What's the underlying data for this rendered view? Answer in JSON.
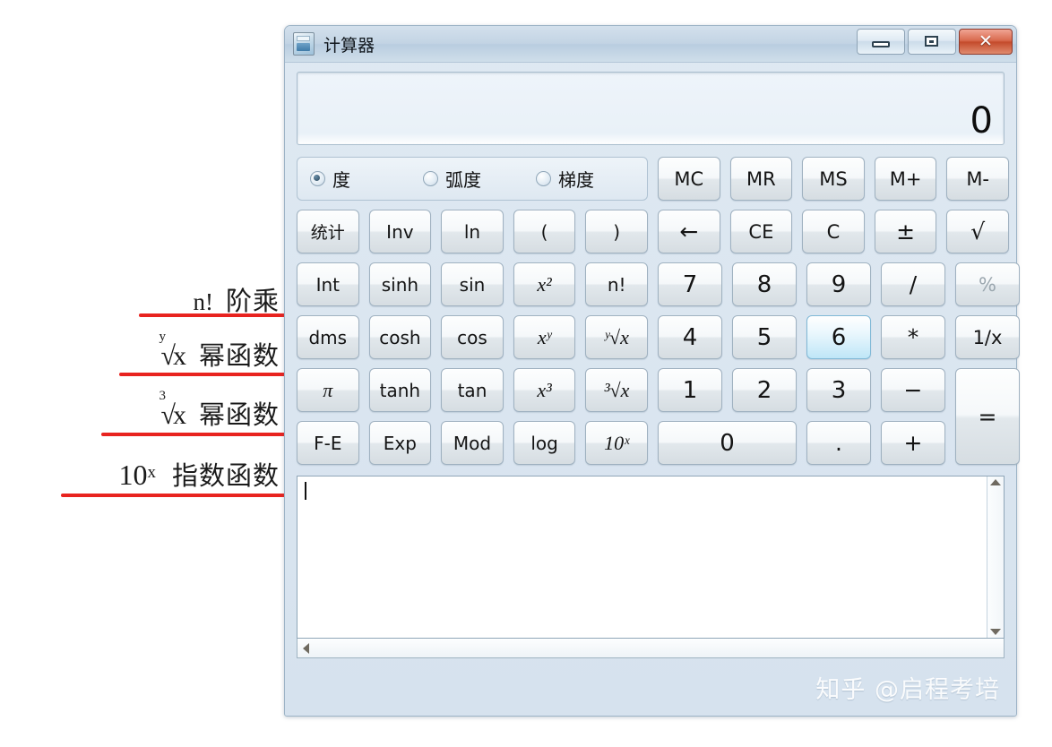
{
  "window": {
    "title": "计算器",
    "icon": "calculator-icon",
    "controls": {
      "minimize": "—",
      "maximize": "□",
      "close": "✕"
    }
  },
  "display": {
    "value": "0"
  },
  "modes": [
    {
      "label": "度",
      "selected": true
    },
    {
      "label": "弧度",
      "selected": false
    },
    {
      "label": "梯度",
      "selected": false
    }
  ],
  "memory_row": [
    "MC",
    "MR",
    "MS",
    "M+",
    "M-"
  ],
  "edit_row": [
    "←",
    "CE",
    "C",
    "±",
    "√"
  ],
  "sci_rows": [
    [
      "统计",
      "Inv",
      "ln",
      "(",
      ")"
    ],
    [
      "Int",
      "sinh",
      "sin",
      "x²",
      "n!"
    ],
    [
      "dms",
      "cosh",
      "cos",
      "xʸ",
      "ʸ√x"
    ],
    [
      "π",
      "tanh",
      "tan",
      "x³",
      "³√x"
    ],
    [
      "F-E",
      "Exp",
      "Mod",
      "log",
      "10ˣ"
    ]
  ],
  "sci_names": [
    [
      "statistics",
      "inverse",
      "natural-log",
      "open-paren",
      "close-paren"
    ],
    [
      "int",
      "sinh",
      "sin",
      "x-squared",
      "factorial"
    ],
    [
      "dms",
      "cosh",
      "cos",
      "x-power-y",
      "y-root-x"
    ],
    [
      "pi",
      "tanh",
      "tan",
      "x-cubed",
      "cube-root-x"
    ],
    [
      "f-e",
      "exp",
      "mod",
      "log",
      "ten-power-x"
    ]
  ],
  "keypad": {
    "row1": [
      "7",
      "8",
      "9",
      "/",
      "%"
    ],
    "row2": [
      "4",
      "5",
      "6",
      "*",
      "1/x"
    ],
    "row3": [
      "1",
      "2",
      "3",
      "−"
    ],
    "row4": [
      "0",
      ".",
      "+"
    ],
    "equals": "=",
    "hovered_key": "6",
    "dim_key": "%"
  },
  "history": {
    "content": "",
    "caret_visible": true
  },
  "annotations": [
    {
      "symbol": "n!",
      "label": "阶乘",
      "type": "plain"
    },
    {
      "symbol": "ʸ√x",
      "label": "幂函数",
      "type": "radical",
      "degree": "y"
    },
    {
      "symbol": "³√x",
      "label": "幂函数",
      "type": "radical",
      "degree": "3"
    },
    {
      "symbol": "10ˣ",
      "label": "指数函数",
      "type": "superscript",
      "base": "10",
      "exp": "x"
    }
  ],
  "watermark": "知乎 @启程考培",
  "colors": {
    "annotation_line": "#e8231f",
    "hover_key": "#bfe6f7",
    "close_button": "#c44b2c",
    "title_bar": "#c3d4e4"
  }
}
